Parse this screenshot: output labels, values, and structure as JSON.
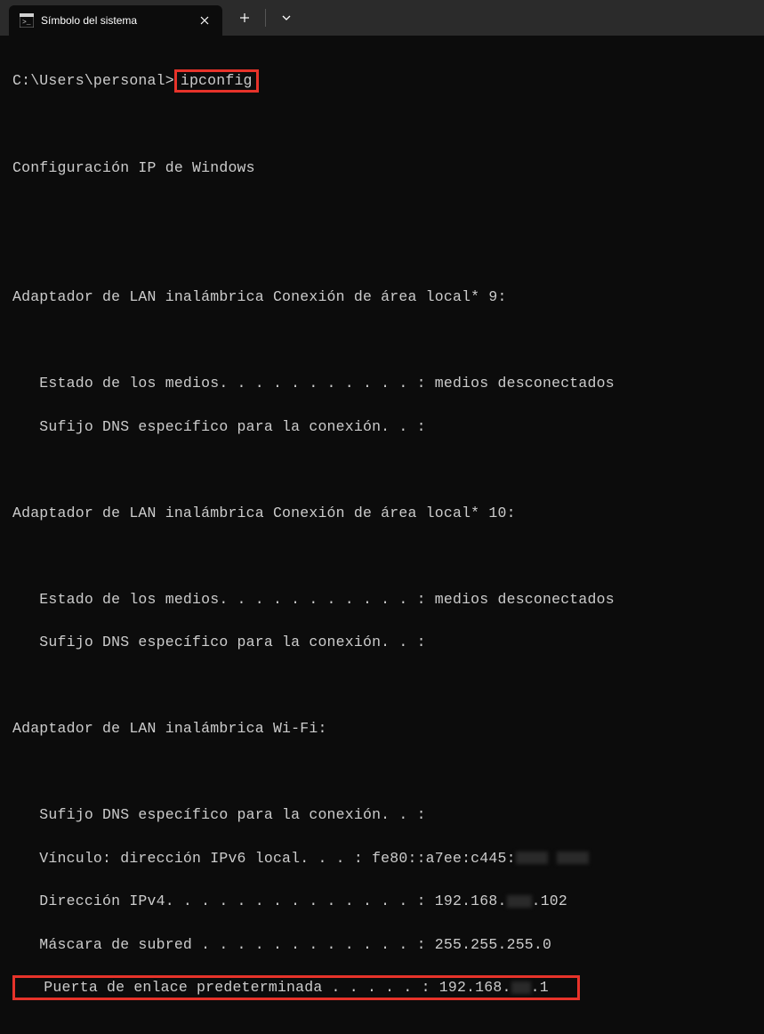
{
  "tab": {
    "title": "Símbolo del sistema"
  },
  "terminal": {
    "prompt_path": "C:\\Users\\personal>",
    "command": "ipconfig",
    "header": "Configuración IP de Windows",
    "adapter1": {
      "title": "Adaptador de LAN inalámbrica Conexión de área local* 9:",
      "media_line": "   Estado de los medios. . . . . . . . . . . : medios desconectados",
      "dns_line": "   Sufijo DNS específico para la conexión. . :"
    },
    "adapter2": {
      "title": "Adaptador de LAN inalámbrica Conexión de área local* 10:",
      "media_line": "   Estado de los medios. . . . . . . . . . . : medios desconectados",
      "dns_line": "   Sufijo DNS específico para la conexión. . :"
    },
    "adapter3": {
      "title": "Adaptador de LAN inalámbrica Wi-Fi:",
      "dns_line": "   Sufijo DNS específico para la conexión. . :",
      "ipv6_prefix": "   Vínculo: dirección IPv6 local. . . : fe80::a7ee:c445:",
      "ipv4_prefix": "   Dirección IPv4. . . . . . . . . . . . . . : 192.168.",
      "ipv4_suffix": ".102",
      "mask_prefix": "   Máscara de subred . . . . . . . . . . . . : 255.255.255.0",
      "gateway_prefix": "   Puerta de enlace predeterminada . . . . . : 192.168.",
      "gateway_suffix": ".1"
    }
  }
}
